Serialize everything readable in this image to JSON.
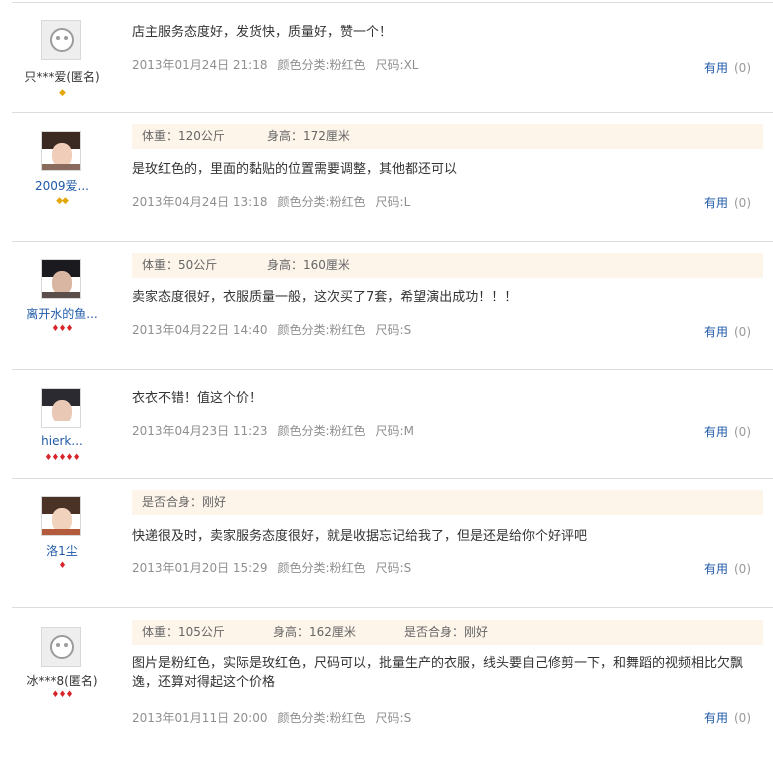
{
  "reviews": [
    {
      "user": "只***爱(匿名)",
      "anonymous": true,
      "avatar": "default-avatar-icon",
      "badges": "◆",
      "badge_color": "gold",
      "specs": [],
      "content": "店主服务态度好，发货快，质量好，赞一个！",
      "date": "2013年01月24日 21:18",
      "sku": "颜色分类:粉红色",
      "size": "尺码:XL",
      "helpful_label": "有用",
      "helpful_count": "(0)"
    },
    {
      "user": "2009爱...",
      "anonymous": false,
      "avatar": "user-photo",
      "badges": "◆◆",
      "badge_color": "gold",
      "specs": [
        "体重：120公斤",
        "身高：172厘米"
      ],
      "content": "是玫红色的，里面的黏贴的位置需要调整，其他都还可以",
      "date": "2013年04月24日 13:18",
      "sku": "颜色分类:粉红色",
      "size": "尺码:L",
      "helpful_label": "有用",
      "helpful_count": "(0)"
    },
    {
      "user": "离开水的鱼...",
      "anonymous": false,
      "avatar": "user-photo",
      "badges": "♦♦♦",
      "badge_color": "red",
      "specs": [
        "体重：50公斤",
        "身高：160厘米"
      ],
      "content": "卖家态度很好，衣服质量一般，这次买了7套，希望演出成功！！！",
      "date": "2013年04月22日 14:40",
      "sku": "颜色分类:粉红色",
      "size": "尺码:S",
      "helpful_label": "有用",
      "helpful_count": "(0)"
    },
    {
      "user": "hierk...",
      "anonymous": false,
      "avatar": "user-photo",
      "badges": "♦♦♦♦♦",
      "badge_color": "red",
      "specs": [],
      "content": "衣衣不错！值这个价！",
      "date": "2013年04月23日 11:23",
      "sku": "颜色分类:粉红色",
      "size": "尺码:M",
      "helpful_label": "有用",
      "helpful_count": "(0)"
    },
    {
      "user": "洛1尘",
      "anonymous": false,
      "avatar": "user-photo",
      "badges": "♦",
      "badge_color": "red",
      "specs": [
        "是否合身：刚好"
      ],
      "content": "快递很及时，卖家服务态度很好，就是收据忘记给我了，但是还是给你个好评吧",
      "date": "2013年01月20日 15:29",
      "sku": "颜色分类:粉红色",
      "size": "尺码:S",
      "helpful_label": "有用",
      "helpful_count": "(0)"
    },
    {
      "user": "冰***8(匿名)",
      "anonymous": true,
      "avatar": "default-avatar-icon",
      "badges": "♦♦♦",
      "badge_color": "red",
      "specs": [
        "体重：105公斤",
        "身高：162厘米",
        "是否合身：刚好"
      ],
      "content": "图片是粉红色，实际是玫红色，尺码可以，批量生产的衣服，线头要自己修剪一下，和舞蹈的视频相比欠飘逸，还算对得起这个价格",
      "date": "2013年01月11日 20:00",
      "sku": "颜色分类:粉红色",
      "size": "尺码:S",
      "helpful_label": "有用",
      "helpful_count": "(0)"
    }
  ]
}
